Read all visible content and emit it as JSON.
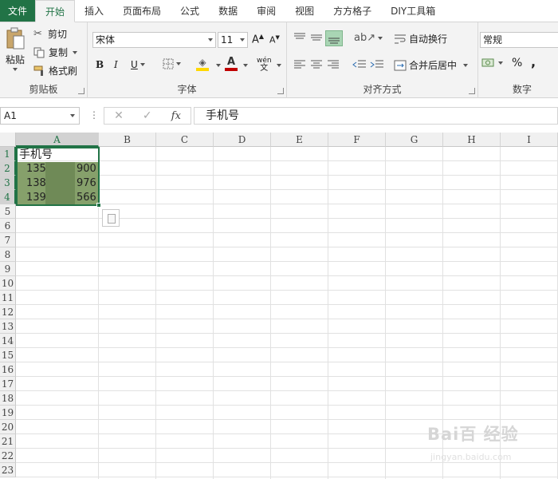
{
  "tabs": [
    {
      "label": "文件"
    },
    {
      "label": "开始"
    },
    {
      "label": "插入"
    },
    {
      "label": "页面布局"
    },
    {
      "label": "公式"
    },
    {
      "label": "数据"
    },
    {
      "label": "审阅"
    },
    {
      "label": "视图"
    },
    {
      "label": "方方格子"
    },
    {
      "label": "DIY工具箱"
    }
  ],
  "active_tab": "开始",
  "clipboard": {
    "paste": "粘贴",
    "cut": "剪切",
    "copy": "复制",
    "format_painter": "格式刷",
    "label": "剪贴板"
  },
  "font": {
    "name": "宋体",
    "size": "11",
    "label": "字体",
    "bold": "B",
    "italic": "I",
    "underline": "U",
    "phonetic": "wén"
  },
  "alignment": {
    "wrap": "自动换行",
    "merge": "合并后居中",
    "label": "对齐方式"
  },
  "number": {
    "format": "常规",
    "percent": "%",
    "comma": ",",
    "label": "数字"
  },
  "formula_bar": {
    "name_box": "A1",
    "content": "手机号",
    "fx": "fx",
    "cancel": "✕",
    "enter": "✓"
  },
  "columns": [
    "A",
    "B",
    "C",
    "D",
    "E",
    "F",
    "G",
    "H",
    "I"
  ],
  "rows": [
    "1",
    "2",
    "3",
    "4",
    "5",
    "6",
    "7",
    "8",
    "9",
    "10",
    "11",
    "12",
    "13",
    "14",
    "15",
    "16",
    "17",
    "18",
    "19",
    "20",
    "21",
    "22",
    "23"
  ],
  "cells": {
    "a1": "手机号",
    "a2_head": "135",
    "a2_tail": "900",
    "a3_head": "138",
    "a3_tail": "976",
    "a4_head": "139",
    "a4_tail": "566"
  },
  "watermark": {
    "brand": "Bai百 经验",
    "url": "jingyan.baidu.com"
  },
  "colors": {
    "accent": "#217346",
    "selection": "#86a06b"
  }
}
